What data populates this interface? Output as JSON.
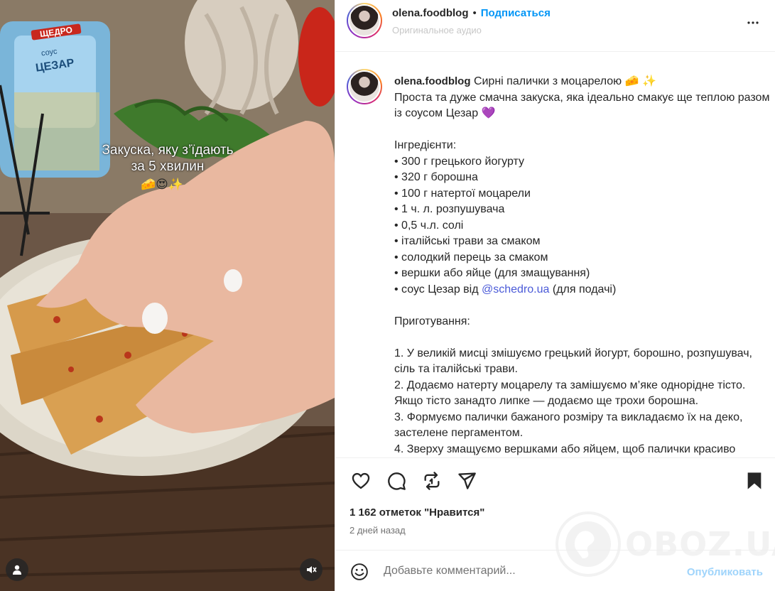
{
  "post": {
    "username": "olena.foodblog",
    "separator": "•",
    "follow_label": "Подписаться",
    "audio_label": "Оригинальное аудио",
    "caption_username": "olena.foodblog",
    "caption_before_mention": "Сирні палички з моцарелою 🧀 ✨\nПроста та дуже смачна закуска, яка ідеально смакує ще теплою разом із соусом Цезар 💜\n\nІнгредієнти:\n• 300 г грецького йогурту\n• 320 г борошна\n• 100 г натертої моцарели\n• 1 ч. л. розпушувача\n• 0,5 ч.л. солі\n• італійські трави за смаком\n• солодкий перець за смаком\n• вершки або яйце (для змащування)\n• соус Цезар від ",
    "caption_mention": "@schedro.ua",
    "caption_after_mention": " (для подачі)\n\nПриготування:\n\n1. У великій мисці змішуємо грецький йогурт, борошно, розпушувач, сіль та італійські трави.\n2. Додаємо натерту моцарелу та замішуємо м’яке однорідне тісто. Якщо тісто занадто липке — додаємо ще трохи борошна.\n3. Формуємо палички бажаного розміру та викладаємо їх на деко, застелене пергаментом.\n4. Зверху змащуємо вершками або яйцем, щоб палички красиво",
    "likes": "1 162 отметок \"Нравится\"",
    "time": "2 дней назад"
  },
  "media": {
    "overlay_line1": "Закуска, яку з’їдають",
    "overlay_line2": "за 5 хвилин",
    "overlay_emoji": "🧀😍✨",
    "jar_brand": "ЩЕДРО",
    "jar_label1": "соус",
    "jar_label2": "ЦЕЗАР"
  },
  "comment": {
    "placeholder": "Добавьте комментарий...",
    "publish_label": "Опубликовать"
  },
  "watermark": {
    "text": "OBOZ.UA"
  },
  "icons": [
    "like-icon",
    "comment-icon",
    "repost-icon",
    "share-icon",
    "save-icon",
    "more-icon",
    "emoji-icon",
    "user-tag-icon",
    "mute-icon"
  ],
  "colors": {
    "link": "#0095f6",
    "publish_disabled": "#9fd4fb",
    "mention": "#4a5ad8"
  }
}
